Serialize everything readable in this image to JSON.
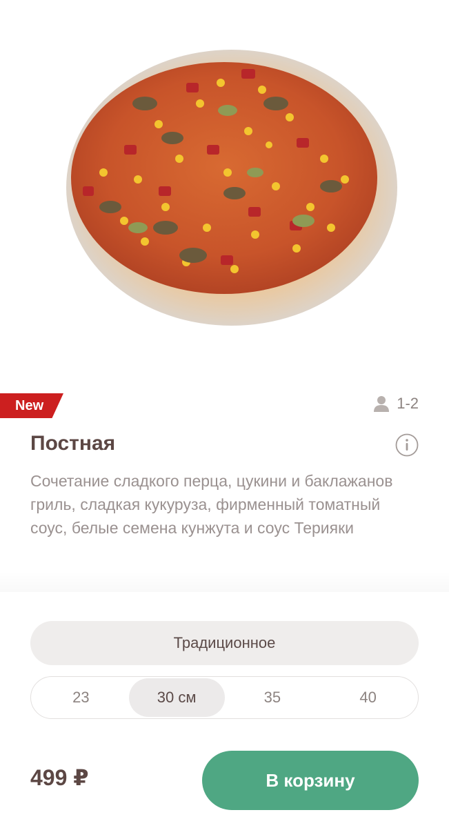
{
  "product": {
    "image_alt": "pizza-image",
    "badge": "New",
    "servings": "1-2",
    "title": "Постная",
    "description": "Сочетание сладкого перца, цукини и баклажанов гриль, сладкая кукуруза, фирменный томатный соус, белые семена кунжута и соус Терияки"
  },
  "options": {
    "crust": "Традиционное",
    "sizes": [
      "23",
      "30 см",
      "35",
      "40"
    ],
    "selected_size_index": 1
  },
  "purchase": {
    "price": "499 ₽",
    "cart_button": "В корзину"
  },
  "colors": {
    "badge": "#cc1f1f",
    "accent": "#4fa783",
    "title": "#5c4744",
    "muted": "#9a9190"
  }
}
